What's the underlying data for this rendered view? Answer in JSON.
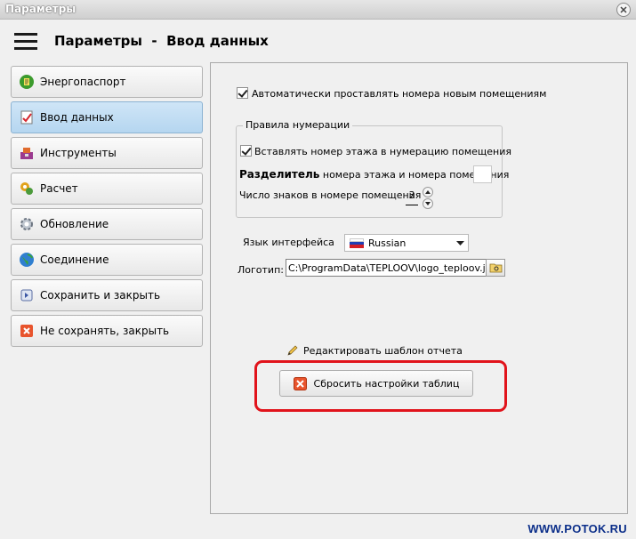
{
  "window": {
    "title": "Параметры"
  },
  "header": {
    "title": "Параметры  -  Ввод данных"
  },
  "sidebar": {
    "items": [
      {
        "label": "Энергопаспорт",
        "icon": "energy-passport-icon"
      },
      {
        "label": "Ввод данных",
        "icon": "data-entry-icon",
        "active": true
      },
      {
        "label": "Инструменты",
        "icon": "tools-icon"
      },
      {
        "label": "Расчет",
        "icon": "calculation-icon"
      },
      {
        "label": "Обновление",
        "icon": "update-icon"
      },
      {
        "label": "Соединение",
        "icon": "connection-icon"
      },
      {
        "label": "Сохранить и закрыть",
        "icon": "save-close-icon"
      },
      {
        "label": "Не сохранять, закрыть",
        "icon": "cancel-close-icon"
      }
    ]
  },
  "settings": {
    "auto_number_label": "Автоматически проставлять номера новым помещениям",
    "auto_number_checked": true,
    "numbering_group": {
      "title": "Правила нумерации",
      "floor_in_number_label": "Вставлять номер этажа в нумерацию помещения",
      "floor_in_number_checked": true,
      "separator_bold": "Разделитель",
      "separator_rest": "номера этажа и номера помещения",
      "separator_value": "",
      "digits_label": "Число знаков в номере помещения",
      "digits_value": "3"
    },
    "language": {
      "label": "Язык интерфейса",
      "value": "Russian"
    },
    "logo": {
      "label": "Логотип:",
      "path": "C:\\ProgramData\\TEPLOOV\\logo_teploov.jpg"
    },
    "edit_template_label": "Редактировать шаблон отчета",
    "reset_tables_label": "Сбросить настройки таблиц"
  },
  "watermark": "WWW.POTOK.RU",
  "colors": {
    "active_nav": "#b5d6f0",
    "highlight": "#e1131b",
    "watermark": "#0c2f8a"
  }
}
